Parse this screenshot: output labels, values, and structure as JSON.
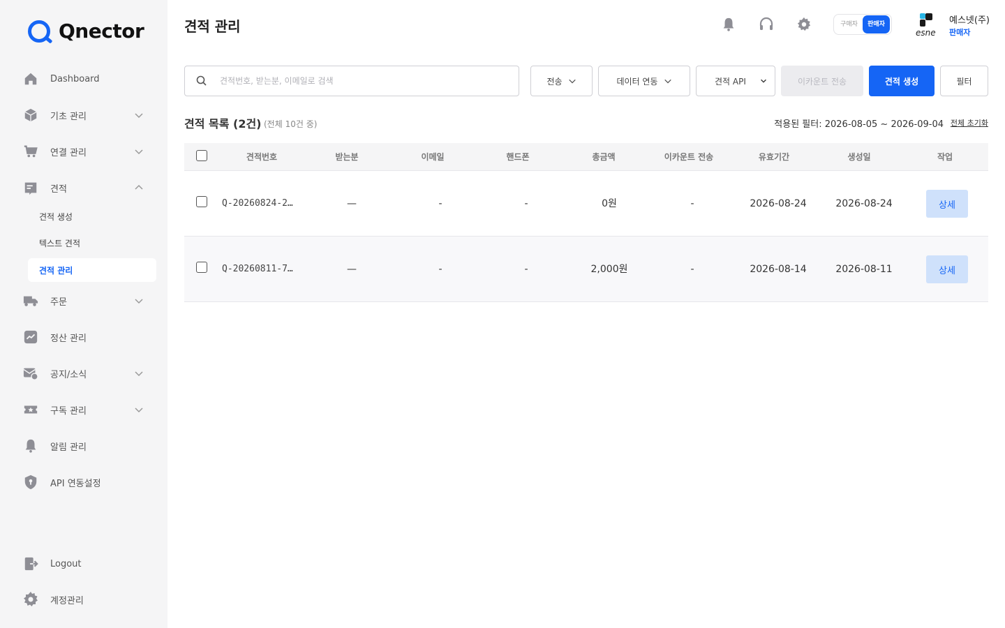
{
  "app": {
    "logo_text": "Qnector"
  },
  "sidebar": {
    "items": [
      {
        "label": "Dashboard"
      },
      {
        "label": "기초 관리"
      },
      {
        "label": "연결 관리"
      },
      {
        "label": "견적"
      },
      {
        "label": "주문"
      },
      {
        "label": "정산 관리"
      },
      {
        "label": "공지/소식"
      },
      {
        "label": "구독 관리"
      },
      {
        "label": "알림 관리"
      },
      {
        "label": "API 연동설정"
      }
    ],
    "sub_items": [
      {
        "label": "견적 생성"
      },
      {
        "label": "텍스트 견적"
      },
      {
        "label": "견적 관리"
      }
    ],
    "footer": [
      {
        "label": "Logout"
      },
      {
        "label": "계정관리"
      }
    ]
  },
  "header": {
    "title": "견적 관리",
    "role_buyer": "구매자",
    "role_seller": "판매자",
    "company_name": "예스넷(주)",
    "company_role": "판매자",
    "company_logo_text": "esne"
  },
  "toolbar": {
    "search_placeholder": "견적번호, 받는분, 이메일로 검색",
    "send_label": "전송",
    "data_link_label": "데이터 연동",
    "api_label": "견적 API",
    "ecount_label": "이카운트 전송",
    "create_label": "견적 생성",
    "filter_label": "필터"
  },
  "list": {
    "title": "견적 목록 (2건)",
    "count_note": "(전체 10건 중)",
    "filter_info": "적용된 필터: 2026-08-05 ~ 2026-09-04",
    "filter_reset": "전체 초기화",
    "columns": [
      "견적번호",
      "받는분",
      "이메일",
      "핸드폰",
      "총금액",
      "이카운트 전송",
      "유효기간",
      "생성일",
      "작업"
    ],
    "rows": [
      {
        "id": "Q-20260824-2…",
        "recipient": "—",
        "email": "-",
        "phone": "-",
        "total": "0원",
        "ecount": "-",
        "valid_until": "2026-08-24",
        "created": "2026-08-24",
        "action": "상세"
      },
      {
        "id": "Q-20260811-7…",
        "recipient": "—",
        "email": "-",
        "phone": "-",
        "total": "2,000원",
        "ecount": "-",
        "valid_until": "2026-08-14",
        "created": "2026-08-11",
        "action": "상세"
      }
    ]
  },
  "colors": {
    "accent": "#1565f5",
    "sidebar_bg": "#f5f5f6",
    "detail_button_bg": "#cfe1fb"
  }
}
